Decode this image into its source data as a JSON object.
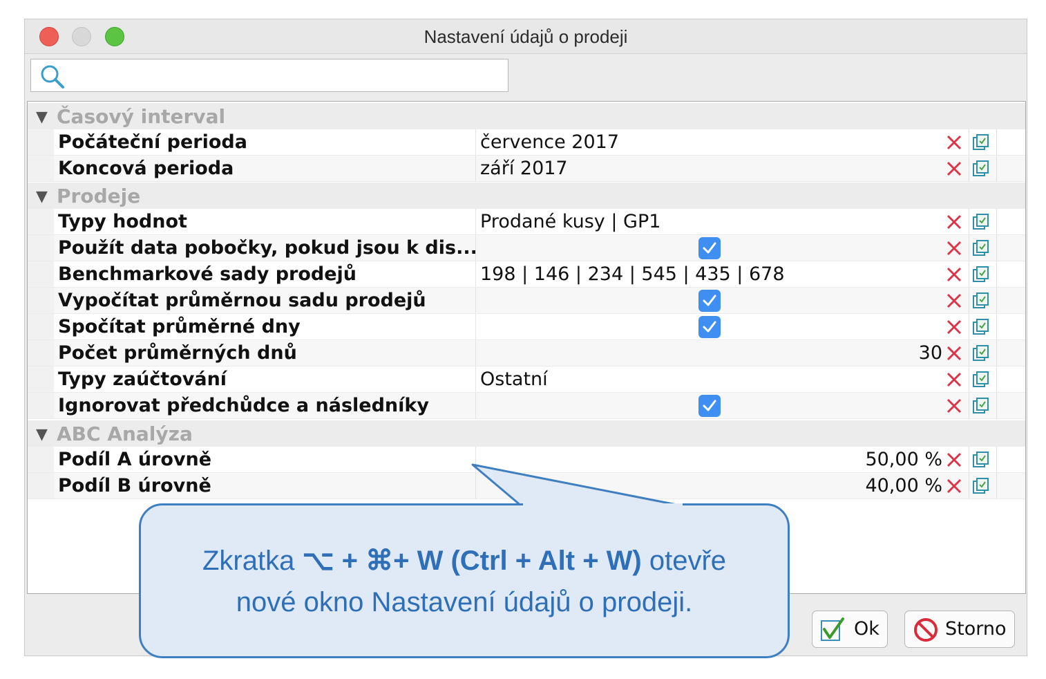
{
  "window": {
    "title": "Nastavení údajů o prodeji"
  },
  "search": {
    "value": "",
    "icon": "search-icon"
  },
  "groups": [
    {
      "label": "Časový interval"
    },
    {
      "label": "Prodeje"
    },
    {
      "label": "ABC Analýza"
    }
  ],
  "rows": [
    {
      "label": "Počáteční perioda",
      "value": "července 2017"
    },
    {
      "label": "Koncová perioda",
      "value": "září 2017"
    },
    {
      "label": "Typy hodnot",
      "value": "Prodané kusy | GP1"
    },
    {
      "label": "Použít data pobočky, pokud jsou k dis...",
      "checked": true
    },
    {
      "label": "Benchmarkové sady prodejů",
      "value": "198 | 146 | 234 | 545 | 435 | 678"
    },
    {
      "label": "Vypočítat průměrnou sadu prodejů",
      "checked": true
    },
    {
      "label": "Spočítat průměrné dny",
      "checked": true
    },
    {
      "label": "Počet průměrných dnů",
      "value": "30"
    },
    {
      "label": "Typy zaúčtování",
      "value": "Ostatní"
    },
    {
      "label": "Ignorovat předchůdce a následníky",
      "checked": true
    },
    {
      "label": "Podíl A úrovně",
      "value": "50,00 %"
    },
    {
      "label": "Podíl B úrovně",
      "value": "40,00 %"
    }
  ],
  "buttons": {
    "ok": "Ok",
    "storno": "Storno"
  },
  "callout": {
    "line1_prefix": "Zkratka ",
    "line1_bold": "⌥ + ⌘+ W (Ctrl + Alt + W)",
    "line1_suffix": " otevře",
    "line2": "nové okno Nastavení údajů o prodeji."
  },
  "colors": {
    "accent": "#3f8ef2",
    "callout_text": "#2f6fb8",
    "delete": "#d9364a"
  }
}
